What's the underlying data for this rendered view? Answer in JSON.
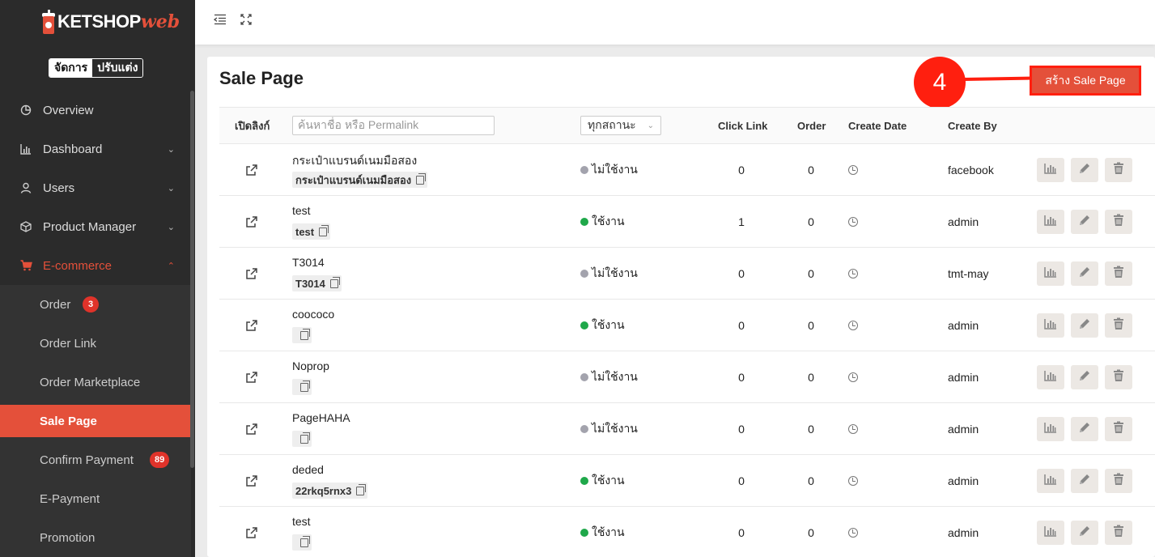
{
  "brand": {
    "name": "KETSHOP",
    "suffix": "web"
  },
  "mode": {
    "manage": "จัดการ",
    "customize": "ปรับแต่ง"
  },
  "sidebar": {
    "items": [
      {
        "label": "Overview",
        "icon": "pie-chart-icon"
      },
      {
        "label": "Dashboard",
        "icon": "bar-chart-icon"
      },
      {
        "label": "Users",
        "icon": "user-icon"
      },
      {
        "label": "Product Manager",
        "icon": "box-icon"
      },
      {
        "label": "E-commerce",
        "icon": "cart-icon"
      }
    ],
    "sub_items": [
      {
        "label": "Order",
        "badge": "3"
      },
      {
        "label": "Order Link"
      },
      {
        "label": "Order Marketplace"
      },
      {
        "label": "Sale Page"
      },
      {
        "label": "Confirm Payment",
        "badge": "89"
      },
      {
        "label": "E-Payment"
      },
      {
        "label": "Promotion"
      }
    ]
  },
  "page": {
    "title": "Sale Page",
    "create_button": "สร้าง Sale Page",
    "step_number": "4"
  },
  "table": {
    "headers": {
      "open_link": "เปิดลิงก์",
      "search_placeholder": "ค้นหาชื่อ หรือ Permalink",
      "status_filter": "ทุกสถานะ",
      "click_link": "Click Link",
      "order": "Order",
      "create_date": "Create Date",
      "create_by": "Create By"
    },
    "rows": [
      {
        "name": "กระเป๋าแบรนด์เนมมือสอง",
        "permalink": "กระเป๋าแบรนด์เนมมือสอง",
        "status": "ไม่ใช้งาน",
        "active": false,
        "click_link": "0",
        "order": "0",
        "create_by": "facebook"
      },
      {
        "name": "test",
        "permalink": "test",
        "status": "ใช้งาน",
        "active": true,
        "click_link": "1",
        "order": "0",
        "create_by": "admin"
      },
      {
        "name": "T3014",
        "permalink": "T3014",
        "status": "ไม่ใช้งาน",
        "active": false,
        "click_link": "0",
        "order": "0",
        "create_by": "tmt-may"
      },
      {
        "name": "coococo",
        "permalink": "",
        "status": "ใช้งาน",
        "active": true,
        "click_link": "0",
        "order": "0",
        "create_by": "admin"
      },
      {
        "name": "Noprop",
        "permalink": "",
        "status": "ไม่ใช้งาน",
        "active": false,
        "click_link": "0",
        "order": "0",
        "create_by": "admin"
      },
      {
        "name": "PageHAHA",
        "permalink": "",
        "status": "ไม่ใช้งาน",
        "active": false,
        "click_link": "0",
        "order": "0",
        "create_by": "admin"
      },
      {
        "name": "deded",
        "permalink": "22rkq5rnx3",
        "status": "ใช้งาน",
        "active": true,
        "click_link": "0",
        "order": "0",
        "create_by": "admin"
      },
      {
        "name": "test",
        "permalink": "",
        "status": "ใช้งาน",
        "active": true,
        "click_link": "0",
        "order": "0",
        "create_by": "admin"
      }
    ]
  },
  "colors": {
    "accent": "#e4503a",
    "active_status": "#1fa84a",
    "inactive_status": "#a3a3ad",
    "annotation": "#ff1f0f"
  }
}
